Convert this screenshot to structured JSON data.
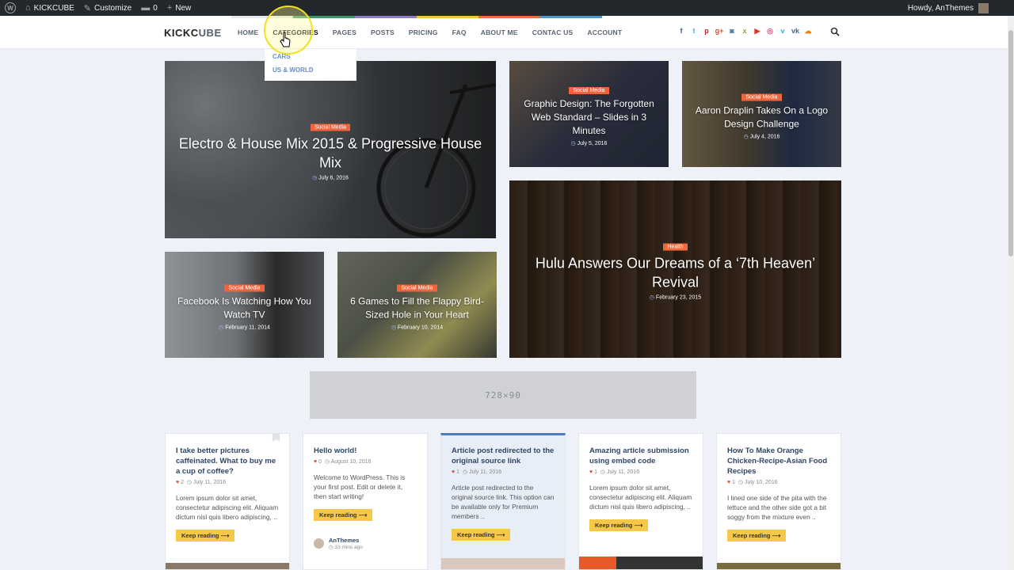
{
  "adminbar": {
    "site_name": "KICKCUBE",
    "customize": "Customize",
    "comments": "0",
    "new": "New",
    "howdy": "Howdy, AnThemes"
  },
  "header": {
    "logo_a": "KICKC",
    "logo_b": "UBE",
    "nav": [
      "HOME",
      "CATEGORIES",
      "PAGES",
      "POSTS",
      "PRICING",
      "FAQ",
      "ABOUT ME",
      "CONTAC US",
      "ACCOUNT"
    ],
    "dropdown": [
      "CARS",
      "US & WORLD"
    ],
    "socials": [
      {
        "icon": "facebook-icon",
        "glyph": "f",
        "color": "#3b5998"
      },
      {
        "icon": "twitter-icon",
        "glyph": "t",
        "color": "#55acee"
      },
      {
        "icon": "pinterest-icon",
        "glyph": "p",
        "color": "#cb2027"
      },
      {
        "icon": "googleplus-icon",
        "glyph": "g+",
        "color": "#dd4b39"
      },
      {
        "icon": "instagram-icon",
        "glyph": "◙",
        "color": "#3f729b"
      },
      {
        "icon": "xing-icon",
        "glyph": "x",
        "color": "#7bb329"
      },
      {
        "icon": "youtube-icon",
        "glyph": "▶",
        "color": "#e52d27"
      },
      {
        "icon": "dribbble-icon",
        "glyph": "◎",
        "color": "#ea4c89"
      },
      {
        "icon": "vimeo-icon",
        "glyph": "v",
        "color": "#1ab7ea"
      },
      {
        "icon": "vk-icon",
        "glyph": "vk",
        "color": "#45668e"
      },
      {
        "icon": "soundcloud-icon",
        "glyph": "☁",
        "color": "#ff7700"
      }
    ]
  },
  "cards": [
    {
      "badge": "Social Media",
      "title": "Electro & House Mix 2015 & Progressive House Mix",
      "date": "July 6, 2016"
    },
    {
      "badge": "Social Media",
      "title": "Graphic Design: The Forgotten Web Standard – Slides in 3 Minutes",
      "date": "July 5, 2016"
    },
    {
      "badge": "Social Media",
      "title": "Aaron Draplin Takes On a Logo Design Challenge",
      "date": "July 4, 2016"
    },
    {
      "badge": "Health",
      "title": "Hulu Answers Our Dreams of a ‘7th Heaven’ Revival",
      "date": "February 23, 2015"
    },
    {
      "badge": "Social Media",
      "title": "Facebook Is Watching How You Watch TV",
      "date": "February 11, 2014"
    },
    {
      "badge": "Social Media",
      "title": "6 Games to Fill the Flappy Bird-Sized Hole in Your Heart",
      "date": "February 10, 2014"
    }
  ],
  "ad": "728×90",
  "keep_reading": "Keep reading ⟶",
  "posts": [
    {
      "title": "I take better pictures caffeinated. What to buy me a cup of coffee?",
      "likes": "2",
      "date": "July 11, 2016",
      "excerpt": "Lorem ipsum dolor sit amet, consectetur adipiscing elit. Aliquam dictum nisl quis libero adipiscing, .."
    },
    {
      "title": "Hello world!",
      "likes": "0",
      "date": "August 10, 2016",
      "excerpt": "Welcome to WordPress. This is your first post. Edit or delete it, then start writing!",
      "author": "AnThemes",
      "time": "33 mins ago"
    },
    {
      "title": "Article post redirected to the original source link",
      "likes": "1",
      "date": "July 11, 2016",
      "excerpt": "Article post redirected to the original source link. This option can be available only for Premium members .."
    },
    {
      "title": "Amazing article submission using embed code",
      "likes": "1",
      "date": "July 11, 2016",
      "excerpt": "Lorem ipsum dolor sit amet, consectetur adipiscing elit. Aliquam dictum nisl quis libero adipiscing, .."
    },
    {
      "title": "How To Make Orange Chicken-Recipe-Asian Food Recipes",
      "likes": "1",
      "date": "July 10, 2016",
      "excerpt": "I lined one side of the pita with the lettuce and the other side got a bit soggy from the mixture even .."
    }
  ]
}
